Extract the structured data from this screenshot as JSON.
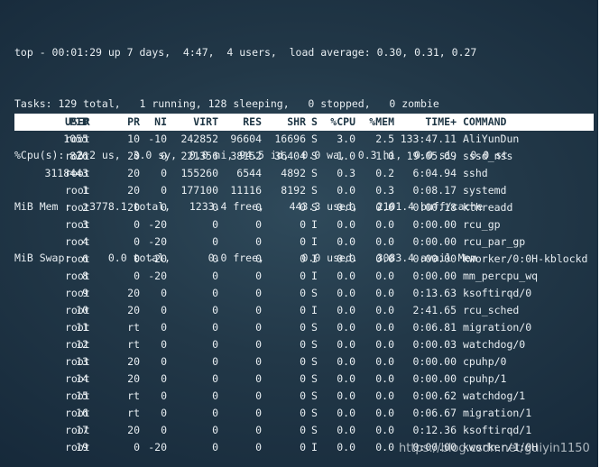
{
  "summary": {
    "line1": "top - 00:01:29 up 7 days,  4:47,  4 users,  load average: 0.30, 0.31, 0.27",
    "line2": "Tasks: 129 total,   1 running, 128 sleeping,   0 stopped,   0 zombie",
    "line3": "%Cpu(s):  2.2 us,  3.0 sy,  0.0 ni, 94.5 id,  0.0 wa,  0.3 hi,  0.0 si,  0.0 st",
    "line4": "MiB Mem :   3778.1 total,   1233.4 free,    443.3 used,   2101.4 buff/cache",
    "line5": "MiB Swap:      0.0 total,      0.0 free,      0.0 used.   3083.4 avail Mem"
  },
  "columns": {
    "pid": "PID",
    "user": "USER",
    "pr": "PR",
    "ni": "NI",
    "virt": "VIRT",
    "res": "RES",
    "shr": "SHR",
    "s": "S",
    "cpu": "%CPU",
    "mem": "%MEM",
    "time": "TIME+",
    "command": "COMMAND"
  },
  "processes": [
    {
      "pid": "1055",
      "user": "root",
      "pr": "10",
      "ni": "-10",
      "virt": "242852",
      "res": "96604",
      "shr": "16696",
      "s": "S",
      "cpu": "3.0",
      "mem": "2.5",
      "time": "133:47.11",
      "command": "AliYunDun"
    },
    {
      "pid": "826",
      "user": "root",
      "pr": "20",
      "ni": "0",
      "virt": "221356",
      "res": "38152",
      "shr": "36404",
      "s": "S",
      "cpu": "1.0",
      "mem": "1.0",
      "time": "19:05.69",
      "command": "sssd_nss"
    },
    {
      "pid": "3118443",
      "user": "root",
      "pr": "20",
      "ni": "0",
      "virt": "155260",
      "res": "6544",
      "shr": "4892",
      "s": "S",
      "cpu": "0.3",
      "mem": "0.2",
      "time": "6:04.94",
      "command": "sshd"
    },
    {
      "pid": "1",
      "user": "root",
      "pr": "20",
      "ni": "0",
      "virt": "177100",
      "res": "11116",
      "shr": "8192",
      "s": "S",
      "cpu": "0.0",
      "mem": "0.3",
      "time": "0:08.17",
      "command": "systemd"
    },
    {
      "pid": "2",
      "user": "root",
      "pr": "20",
      "ni": "0",
      "virt": "0",
      "res": "0",
      "shr": "0",
      "s": "S",
      "cpu": "0.0",
      "mem": "0.0",
      "time": "0:00.18",
      "command": "kthreadd"
    },
    {
      "pid": "3",
      "user": "root",
      "pr": "0",
      "ni": "-20",
      "virt": "0",
      "res": "0",
      "shr": "0",
      "s": "I",
      "cpu": "0.0",
      "mem": "0.0",
      "time": "0:00.00",
      "command": "rcu_gp"
    },
    {
      "pid": "4",
      "user": "root",
      "pr": "0",
      "ni": "-20",
      "virt": "0",
      "res": "0",
      "shr": "0",
      "s": "I",
      "cpu": "0.0",
      "mem": "0.0",
      "time": "0:00.00",
      "command": "rcu_par_gp"
    },
    {
      "pid": "6",
      "user": "root",
      "pr": "0",
      "ni": "-20",
      "virt": "0",
      "res": "0",
      "shr": "0",
      "s": "I",
      "cpu": "0.0",
      "mem": "0.0",
      "time": "0:00.00",
      "command": "kworker/0:0H-kblockd"
    },
    {
      "pid": "8",
      "user": "root",
      "pr": "0",
      "ni": "-20",
      "virt": "0",
      "res": "0",
      "shr": "0",
      "s": "I",
      "cpu": "0.0",
      "mem": "0.0",
      "time": "0:00.00",
      "command": "mm_percpu_wq"
    },
    {
      "pid": "9",
      "user": "root",
      "pr": "20",
      "ni": "0",
      "virt": "0",
      "res": "0",
      "shr": "0",
      "s": "S",
      "cpu": "0.0",
      "mem": "0.0",
      "time": "0:13.63",
      "command": "ksoftirqd/0"
    },
    {
      "pid": "10",
      "user": "root",
      "pr": "20",
      "ni": "0",
      "virt": "0",
      "res": "0",
      "shr": "0",
      "s": "I",
      "cpu": "0.0",
      "mem": "0.0",
      "time": "2:41.65",
      "command": "rcu_sched"
    },
    {
      "pid": "11",
      "user": "root",
      "pr": "rt",
      "ni": "0",
      "virt": "0",
      "res": "0",
      "shr": "0",
      "s": "S",
      "cpu": "0.0",
      "mem": "0.0",
      "time": "0:06.81",
      "command": "migration/0"
    },
    {
      "pid": "12",
      "user": "root",
      "pr": "rt",
      "ni": "0",
      "virt": "0",
      "res": "0",
      "shr": "0",
      "s": "S",
      "cpu": "0.0",
      "mem": "0.0",
      "time": "0:00.03",
      "command": "watchdog/0"
    },
    {
      "pid": "13",
      "user": "root",
      "pr": "20",
      "ni": "0",
      "virt": "0",
      "res": "0",
      "shr": "0",
      "s": "S",
      "cpu": "0.0",
      "mem": "0.0",
      "time": "0:00.00",
      "command": "cpuhp/0"
    },
    {
      "pid": "14",
      "user": "root",
      "pr": "20",
      "ni": "0",
      "virt": "0",
      "res": "0",
      "shr": "0",
      "s": "S",
      "cpu": "0.0",
      "mem": "0.0",
      "time": "0:00.00",
      "command": "cpuhp/1"
    },
    {
      "pid": "15",
      "user": "root",
      "pr": "rt",
      "ni": "0",
      "virt": "0",
      "res": "0",
      "shr": "0",
      "s": "S",
      "cpu": "0.0",
      "mem": "0.0",
      "time": "0:00.62",
      "command": "watchdog/1"
    },
    {
      "pid": "16",
      "user": "root",
      "pr": "rt",
      "ni": "0",
      "virt": "0",
      "res": "0",
      "shr": "0",
      "s": "S",
      "cpu": "0.0",
      "mem": "0.0",
      "time": "0:06.67",
      "command": "migration/1"
    },
    {
      "pid": "17",
      "user": "root",
      "pr": "20",
      "ni": "0",
      "virt": "0",
      "res": "0",
      "shr": "0",
      "s": "S",
      "cpu": "0.0",
      "mem": "0.0",
      "time": "0:12.36",
      "command": "ksoftirqd/1"
    },
    {
      "pid": "19",
      "user": "root",
      "pr": "0",
      "ni": "-20",
      "virt": "0",
      "res": "0",
      "shr": "0",
      "s": "I",
      "cpu": "0.0",
      "mem": "0.0",
      "time": "0:00.00",
      "command": "kworker/1:0H"
    }
  ],
  "watermark": "https://blog.csdn.net/guiyin1150",
  "colors": {
    "terminal_bg": "#223848",
    "text": "#e8eef2",
    "header_bar": "#ffffff",
    "header_text": "#1c3443"
  }
}
